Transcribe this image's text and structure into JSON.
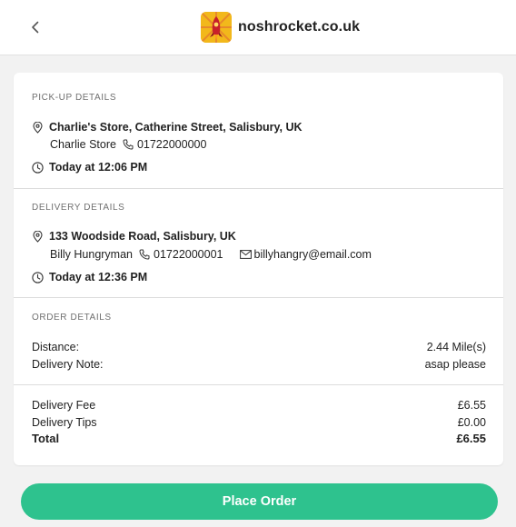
{
  "header": {
    "brand_name": "noshrocket.co.uk"
  },
  "pickup": {
    "title": "PICK-UP DETAILS",
    "address": "Charlie's Store, Catherine Street, Salisbury, UK",
    "contact_name": "Charlie Store",
    "phone": "01722000000",
    "time": "Today at 12:06 PM"
  },
  "delivery": {
    "title": "DELIVERY DETAILS",
    "address": "133 Woodside Road, Salisbury, UK",
    "contact_name": "Billy Hungryman",
    "phone": "01722000001",
    "email": "billyhangry@email.com",
    "time": "Today at 12:36 PM"
  },
  "order": {
    "title": "ORDER DETAILS",
    "distance_label": "Distance:",
    "distance_value": "2.44 Mile(s)",
    "note_label": "Delivery Note:",
    "note_value": "asap please",
    "fee_label": "Delivery Fee",
    "fee_value": "£6.55",
    "tips_label": "Delivery Tips",
    "tips_value": "£0.00",
    "total_label": "Total",
    "total_value": "£6.55"
  },
  "actions": {
    "place_order_label": "Place Order"
  },
  "colors": {
    "accent": "#2ec28e",
    "logo_background": "#f2b81b",
    "page_background": "#f2f2f2"
  },
  "icons": {
    "back": "chevron-left-icon",
    "location": "map-pin-icon",
    "phone": "phone-icon",
    "email": "envelope-icon",
    "time": "clock-icon"
  }
}
